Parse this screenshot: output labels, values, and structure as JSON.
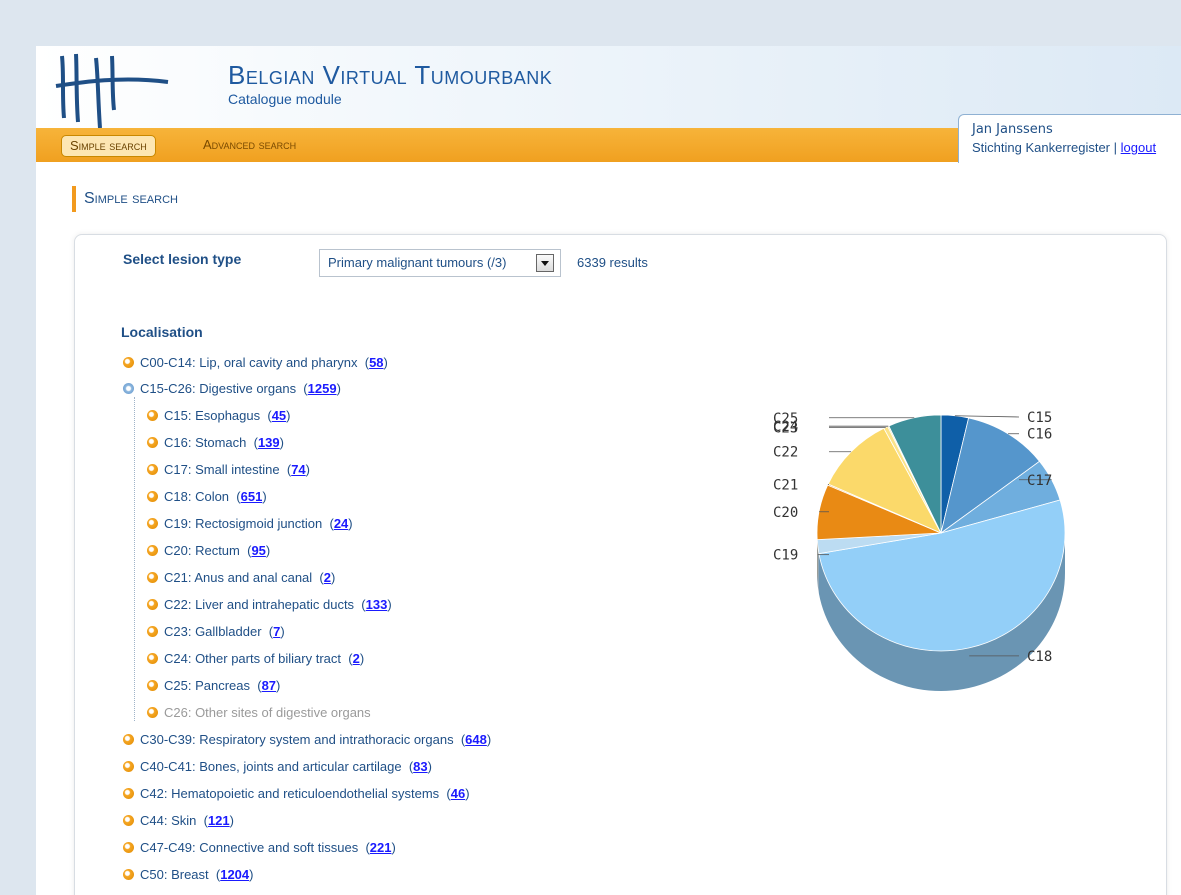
{
  "app": {
    "title": "Belgian Virtual Tumourbank",
    "subtitle": "Catalogue module"
  },
  "nav": {
    "tabs": [
      {
        "label": "Simple search",
        "active": true
      },
      {
        "label": "Advanced search",
        "active": false
      }
    ]
  },
  "user": {
    "name": "Jan Janssens",
    "organisation": "Stichting Kankerregister",
    "separator": "|",
    "logout_label": "logout"
  },
  "page": {
    "title": "Simple search"
  },
  "lesion": {
    "label": "Select lesion type",
    "selected": "Primary malignant tumours (/3)",
    "results": "6339 results"
  },
  "localisation": {
    "label": "Localisation",
    "items": [
      {
        "code": "C00-C14: Lip, oral cavity and pharynx",
        "count": "58",
        "level": 0,
        "expanded": false
      },
      {
        "code": "C15-C26: Digestive organs",
        "count": "1259",
        "level": 0,
        "expanded": true
      },
      {
        "code": "C15: Esophagus",
        "count": "45",
        "level": 1
      },
      {
        "code": "C16: Stomach",
        "count": "139",
        "level": 1
      },
      {
        "code": "C17: Small intestine",
        "count": "74",
        "level": 1
      },
      {
        "code": "C18: Colon",
        "count": "651",
        "level": 1
      },
      {
        "code": "C19: Rectosigmoid junction",
        "count": "24",
        "level": 1
      },
      {
        "code": "C20: Rectum",
        "count": "95",
        "level": 1
      },
      {
        "code": "C21: Anus and anal canal",
        "count": "2",
        "level": 1
      },
      {
        "code": "C22: Liver and intrahepatic ducts",
        "count": "133",
        "level": 1
      },
      {
        "code": "C23: Gallbladder",
        "count": "7",
        "level": 1
      },
      {
        "code": "C24: Other parts of biliary tract",
        "count": "2",
        "level": 1
      },
      {
        "code": "C25: Pancreas",
        "count": "87",
        "level": 1
      },
      {
        "code": "C26: Other sites of digestive organs",
        "count": "",
        "level": 1,
        "muted": true
      },
      {
        "code": "C30-C39: Respiratory system and intrathoracic organs",
        "count": "648",
        "level": 0
      },
      {
        "code": "C40-C41: Bones, joints and articular cartilage",
        "count": "83",
        "level": 0
      },
      {
        "code": "C42: Hematopoietic and reticuloendothelial systems",
        "count": "46",
        "level": 0
      },
      {
        "code": "C44: Skin",
        "count": "121",
        "level": 0
      },
      {
        "code": "C47-C49: Connective and soft tissues",
        "count": "221",
        "level": 0
      },
      {
        "code": "C50: Breast",
        "count": "1204",
        "level": 0
      }
    ]
  },
  "chart_data": {
    "type": "pie",
    "labels": [
      "C15",
      "C16",
      "C17",
      "C18",
      "C19",
      "C20",
      "C21",
      "C22",
      "C23",
      "C24",
      "C25"
    ],
    "values": [
      45,
      139,
      74,
      651,
      24,
      95,
      2,
      133,
      7,
      2,
      87
    ],
    "colors": [
      "#0f5fa8",
      "#5596cc",
      "#6faede",
      "#93cff8",
      "#bcdcf2",
      "#e98a14",
      "#f0a33a",
      "#fbd96a",
      "#fbe38a",
      "#e8dfa0",
      "#3d8f9a"
    ]
  }
}
